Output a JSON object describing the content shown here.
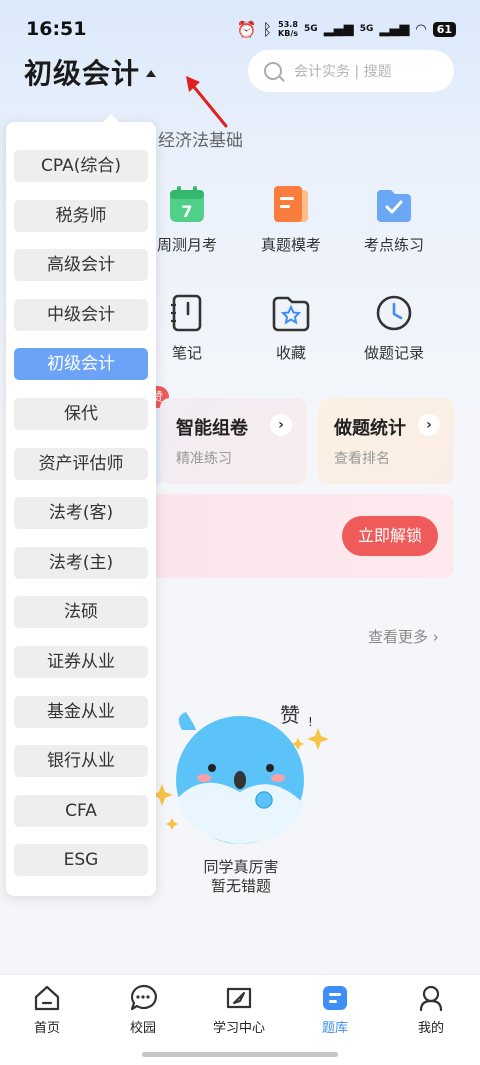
{
  "status_bar": {
    "time": "16:51",
    "net_speed_value": "53.8",
    "net_speed_unit": "KB/s",
    "signal1": "5G",
    "signal2": "5G",
    "battery": "61"
  },
  "header": {
    "title": "初级会计",
    "search_placeholder": "会计实务 | 搜题"
  },
  "subject_tab": "经济法基础",
  "functions": [
    {
      "label": "周测月考",
      "icon": "calendar-icon"
    },
    {
      "label": "真题模考",
      "icon": "exam-paper-icon"
    },
    {
      "label": "考点练习",
      "icon": "folder-check-icon"
    },
    {
      "label": "笔记",
      "icon": "notebook-icon"
    },
    {
      "label": "收藏",
      "icon": "star-folder-icon"
    },
    {
      "label": "做题记录",
      "icon": "clock-icon"
    }
  ],
  "calendar_day": "7",
  "badge": "赞",
  "cards": [
    {
      "title": "智能组卷",
      "subtitle": "精准练习"
    },
    {
      "title": "做题统计",
      "subtitle": "查看排名"
    }
  ],
  "unlock_button": "立即解锁",
  "see_more": "查看更多",
  "empty_state": {
    "praise": "赞",
    "line1": "同学真厉害",
    "line2": "暂无错题"
  },
  "dropdown": {
    "selected": "初级会计",
    "items": [
      "CPA(综合)",
      "税务师",
      "高级会计",
      "中级会计",
      "初级会计",
      "保代",
      "资产评估师",
      "法考(客)",
      "法考(主)",
      "法硕",
      "证券从业",
      "基金从业",
      "银行从业",
      "CFA",
      "ESG"
    ]
  },
  "bottom_nav": [
    {
      "label": "首页",
      "icon": "home-icon"
    },
    {
      "label": "校园",
      "icon": "chat-icon"
    },
    {
      "label": "学习中心",
      "icon": "compass-icon"
    },
    {
      "label": "题库",
      "icon": "question-bank-icon"
    },
    {
      "label": "我的",
      "icon": "profile-icon"
    }
  ],
  "colors": {
    "accent_blue": "#3f8ef5",
    "selected_item": "#6da3f7",
    "unlock_red": "#ef5a5a",
    "annotation_arrow": "#e0201c"
  }
}
